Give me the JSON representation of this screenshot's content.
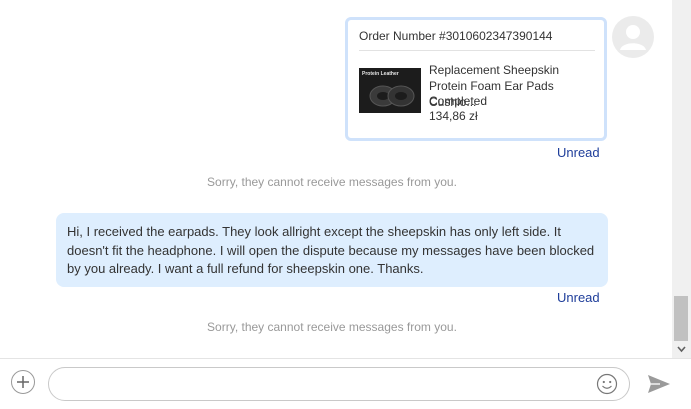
{
  "order_card": {
    "order_number": "Order Number #3010602347390144",
    "product_title": "Replacement Sheepskin Protein Foam Ear Pads Cushio...",
    "status": "Completed",
    "price": "134,86 zł",
    "thumbnail_label": "Protein Leather"
  },
  "messages": [
    {
      "text": "Hi, I received the earpads. They look allright except the sheepskin has only left side. It doesn't fit the headphone. I will open the dispute because my messages have been blocked by you already. I want a full refund for sheepskin one. Thanks."
    }
  ],
  "read_status": [
    "Unread",
    "Unread"
  ],
  "system_notices": [
    "Sorry, they cannot receive messages from you.",
    "Sorry, they cannot receive messages from you."
  ],
  "composer": {
    "value": "",
    "placeholder": ""
  },
  "icons": {
    "avatar": "user-avatar-icon",
    "add": "plus-circle-icon",
    "emoji": "smiley-face-icon",
    "send": "paper-plane-icon",
    "scroll_down": "chevron-down-icon"
  },
  "colors": {
    "bubble": "#deeefe",
    "card_border": "#cfe2fb",
    "unread_link": "#1e3d9a",
    "notice_text": "#999999"
  }
}
